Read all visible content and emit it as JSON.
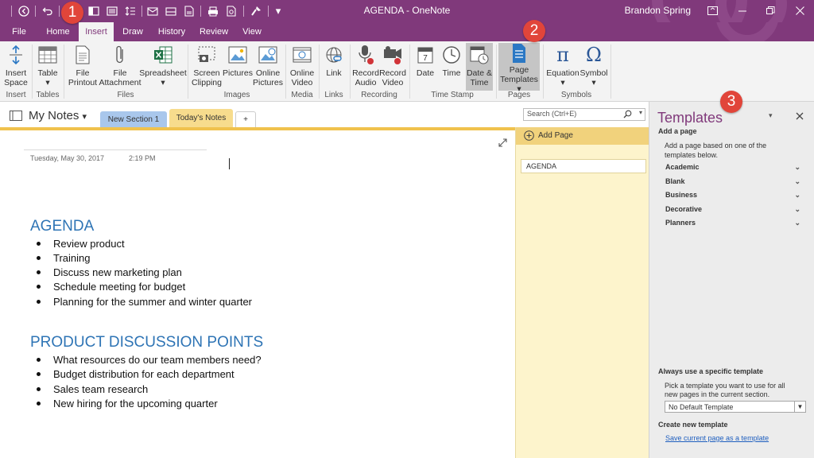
{
  "titlebar": {
    "title": "AGENDA - OneNote",
    "user": "Brandon Spring",
    "customize_glyph": "▾"
  },
  "ribbon_tabs": [
    "File",
    "Home",
    "Insert",
    "Draw",
    "History",
    "Review",
    "View"
  ],
  "active_tab": "Insert",
  "ribbon_groups": [
    {
      "label": "Insert",
      "buttons": [
        {
          "lines": [
            "Insert",
            "Space"
          ],
          "icon": "insert-space-icon"
        }
      ]
    },
    {
      "label": "Tables",
      "buttons": [
        {
          "lines": [
            "Table",
            "▾"
          ],
          "icon": "table-icon"
        }
      ]
    },
    {
      "label": "Files",
      "buttons": [
        {
          "lines": [
            "File",
            "Printout"
          ],
          "icon": "file-printout-icon"
        },
        {
          "lines": [
            "File",
            "Attachment"
          ],
          "icon": "paperclip-icon"
        },
        {
          "lines": [
            "Spreadsheet",
            "▾"
          ],
          "icon": "excel-icon"
        }
      ]
    },
    {
      "label": "Images",
      "buttons": [
        {
          "lines": [
            "Screen",
            "Clipping"
          ],
          "icon": "screen-clipping-icon"
        },
        {
          "lines": [
            "Pictures",
            ""
          ],
          "icon": "picture-icon"
        },
        {
          "lines": [
            "Online",
            "Pictures"
          ],
          "icon": "online-picture-icon"
        }
      ]
    },
    {
      "label": "Media",
      "buttons": [
        {
          "lines": [
            "Online",
            "Video"
          ],
          "icon": "online-video-icon"
        }
      ]
    },
    {
      "label": "Links",
      "buttons": [
        {
          "lines": [
            "Link",
            ""
          ],
          "icon": "link-globe-icon"
        }
      ]
    },
    {
      "label": "Recording",
      "buttons": [
        {
          "lines": [
            "Record",
            "Audio"
          ],
          "icon": "microphone-icon"
        },
        {
          "lines": [
            "Record",
            "Video"
          ],
          "icon": "video-camera-icon"
        }
      ]
    },
    {
      "label": "Time Stamp",
      "buttons": [
        {
          "lines": [
            "Date",
            ""
          ],
          "icon": "calendar-icon"
        },
        {
          "lines": [
            "Time",
            ""
          ],
          "icon": "clock-icon"
        },
        {
          "lines": [
            "Date &",
            "Time"
          ],
          "icon": "date-time-icon"
        }
      ]
    },
    {
      "label": "Pages",
      "buttons": [
        {
          "lines": [
            "Page",
            "Templates ▾"
          ],
          "icon": "page-templates-icon"
        }
      ]
    },
    {
      "label": "Symbols",
      "buttons": [
        {
          "lines": [
            "Equation",
            "▾"
          ],
          "icon": "pi-icon",
          "glyph": "π"
        },
        {
          "lines": [
            "Symbol",
            "▾"
          ],
          "icon": "omega-icon",
          "glyph": "Ω"
        }
      ]
    }
  ],
  "notebook": {
    "name": "My Notes",
    "sections": [
      "New Section 1",
      "Today's Notes"
    ],
    "add_section": "+",
    "search_placeholder": "Search (Ctrl+E)"
  },
  "page": {
    "date": "Tuesday, May 30, 2017",
    "time": "2:19 PM",
    "heading1": "AGENDA",
    "list1": [
      "Review product",
      "Training",
      "Discuss new marketing plan",
      "Schedule meeting for budget",
      "Planning for the summer and winter quarter"
    ],
    "heading2": "PRODUCT DISCUSSION POINTS",
    "list2": [
      "What resources do our team members need?",
      "Budget distribution for each department",
      "Sales team research",
      "New hiring for the upcoming quarter"
    ]
  },
  "pagelist": {
    "add_page": "Add Page",
    "pages": [
      "AGENDA"
    ]
  },
  "templates": {
    "title": "Templates",
    "add_page_heading": "Add a page",
    "add_page_desc_1": "Add a page based on one of the",
    "add_page_desc_2": "templates below.",
    "categories": [
      "Academic",
      "Blank",
      "Business",
      "Decorative",
      "Planners"
    ],
    "always_heading": "Always use a specific template",
    "always_desc_1": "Pick a template you want to use for all",
    "always_desc_2": "new pages in the current section.",
    "selected_template": "No Default Template",
    "create_heading": "Create new template",
    "save_link": "Save current page as a template"
  },
  "badges": [
    "1",
    "2",
    "3"
  ],
  "colors": {
    "onenote_purple": "#80397b",
    "section_blue": "#a9c7ec",
    "section_yellow": "#f7dc8d",
    "heading_blue": "#2e74b5",
    "badge_red": "#e1453a"
  }
}
